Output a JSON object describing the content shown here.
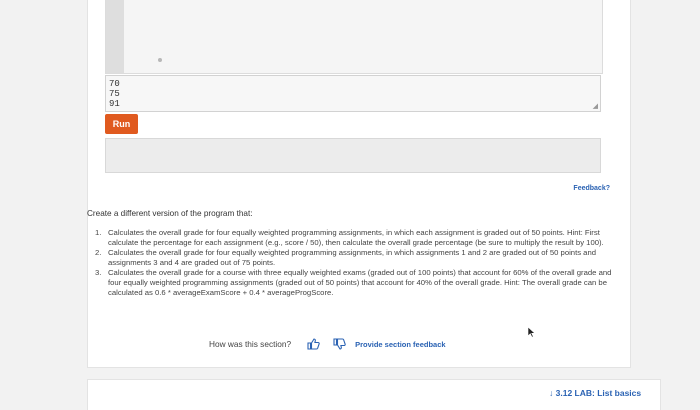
{
  "input": {
    "lines": [
      "70",
      "75",
      "91"
    ]
  },
  "run_button": {
    "label": "Run"
  },
  "feedback": {
    "label": "Feedback?"
  },
  "activity": {
    "prompt": "Create a different version of the program that:",
    "tasks": [
      {
        "num": "1.",
        "text": "Calculates the overall grade for four equally weighted programming assignments, in which each assignment is graded out of 50 points. Hint: First calculate the percentage for each assignment (e.g., score / 50), then calculate the overall grade percentage (be sure to multiply the result by 100)."
      },
      {
        "num": "2.",
        "text": "Calculates the overall grade for four equally weighted programming assignments, in which assignments 1 and 2 are graded out of 50 points and assignments 3 and 4 are graded out of 75 points."
      },
      {
        "num": "3.",
        "text": "Calculates the overall grade for a course with three equally weighted exams (graded out of 100 points) that account for 60% of the overall grade and four equally weighted programming assignments (graded out of 50 points) that account for 40% of the overall grade. Hint: The overall grade can be calculated as 0.6 * averageExamScore + 0.4 * averageProgScore."
      }
    ]
  },
  "section_feedback": {
    "question": "How was this section?",
    "provide_label": "Provide section feedback"
  },
  "next_section": {
    "label": "3.12 LAB: List basics"
  },
  "colors": {
    "accent": "#e05a1f",
    "link": "#2a62b3"
  },
  "icons": [
    "thumbs-up-icon",
    "thumbs-down-icon",
    "resize-handle-icon",
    "mouse-cursor-icon",
    "down-arrow-icon"
  ]
}
